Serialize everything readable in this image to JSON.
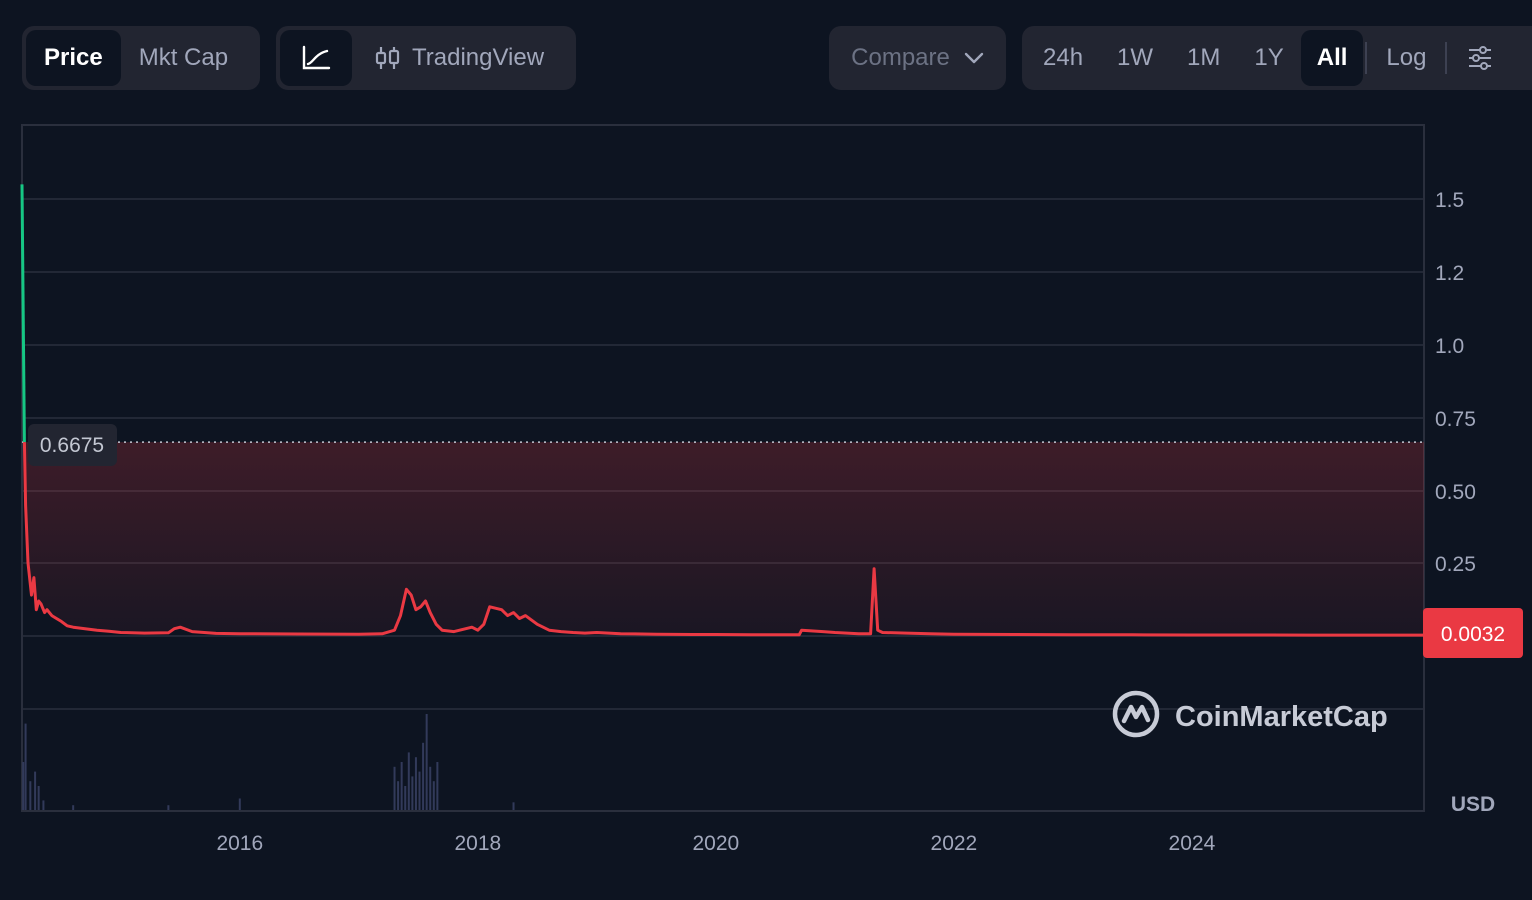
{
  "toolbar": {
    "price_label": "Price",
    "mktcap_label": "Mkt Cap",
    "tradingview_label": "TradingView",
    "compare_label": "Compare",
    "ranges": [
      "24h",
      "1W",
      "1M",
      "1Y",
      "All"
    ],
    "active_range": "All",
    "log_label": "Log"
  },
  "colors": {
    "background": "#0d1421",
    "line_down": "#ea3943",
    "line_up": "#16c784",
    "grid": "#2a2f3d",
    "volume": "#323a5a"
  },
  "watermark": "CoinMarketCap",
  "currency": "USD",
  "chart_data": {
    "type": "line",
    "yticks": [
      "1.5",
      "1.2",
      "1.0",
      "0.75",
      "0.50",
      "0.25"
    ],
    "xticks": [
      "2016",
      "2018",
      "2020",
      "2022",
      "2024"
    ],
    "start_price_label": "0.6675",
    "current_price_label": "0.0032",
    "start_price": 0.6675,
    "current_price": 0.0032,
    "ylim": [
      0,
      1.75
    ],
    "xlim": [
      2014.17,
      2025.95
    ],
    "series": [
      {
        "x": [
          2014.17,
          2014.19,
          2014.2,
          2014.22,
          2014.25,
          2014.27,
          2014.29,
          2014.31,
          2014.33,
          2014.36,
          2014.38,
          2014.42,
          2014.46,
          2014.5,
          2014.55,
          2014.6,
          2014.7,
          2014.8,
          2014.9,
          2015.0,
          2015.2,
          2015.4,
          2015.45,
          2015.5,
          2015.6,
          2015.8,
          2016.0,
          2016.5,
          2017.0,
          2017.2,
          2017.3,
          2017.35,
          2017.4,
          2017.44,
          2017.48,
          2017.52,
          2017.56,
          2017.6,
          2017.65,
          2017.7,
          2017.8,
          2017.95,
          2018.0,
          2018.05,
          2018.1,
          2018.2,
          2018.25,
          2018.3,
          2018.35,
          2018.4,
          2018.5,
          2018.6,
          2018.7,
          2018.8,
          2018.9,
          2019.0,
          2019.2,
          2019.5,
          2019.8,
          2020.0,
          2020.3,
          2020.7,
          2020.72,
          2020.9,
          2021.0,
          2021.1,
          2021.2,
          2021.3,
          2021.33,
          2021.36,
          2021.4,
          2021.6,
          2021.8,
          2022.0,
          2022.5,
          2023.0,
          2023.5,
          2024.0,
          2024.5,
          2025.0,
          2025.5,
          2025.95
        ],
        "y": [
          1.55,
          0.6675,
          0.45,
          0.25,
          0.14,
          0.2,
          0.09,
          0.12,
          0.11,
          0.08,
          0.09,
          0.07,
          0.06,
          0.05,
          0.035,
          0.03,
          0.025,
          0.02,
          0.016,
          0.012,
          0.01,
          0.011,
          0.025,
          0.03,
          0.015,
          0.009,
          0.008,
          0.007,
          0.006,
          0.008,
          0.02,
          0.07,
          0.16,
          0.14,
          0.09,
          0.1,
          0.12,
          0.08,
          0.04,
          0.02,
          0.015,
          0.03,
          0.02,
          0.04,
          0.1,
          0.09,
          0.07,
          0.08,
          0.06,
          0.07,
          0.04,
          0.02,
          0.015,
          0.012,
          0.01,
          0.012,
          0.008,
          0.006,
          0.005,
          0.005,
          0.004,
          0.004,
          0.02,
          0.015,
          0.012,
          0.01,
          0.008,
          0.008,
          0.23,
          0.02,
          0.012,
          0.01,
          0.008,
          0.006,
          0.005,
          0.004,
          0.004,
          0.0035,
          0.0033,
          0.0032,
          0.0032,
          0.0032
        ]
      }
    ],
    "volume": {
      "x": [
        2014.18,
        2014.2,
        2014.24,
        2014.28,
        2014.31,
        2014.35,
        2014.6,
        2015.4,
        2016.0,
        2017.3,
        2017.33,
        2017.36,
        2017.39,
        2017.42,
        2017.45,
        2017.48,
        2017.51,
        2017.54,
        2017.57,
        2017.6,
        2017.63,
        2017.66,
        2018.3
      ],
      "v": [
        0.5,
        0.9,
        0.3,
        0.4,
        0.25,
        0.1,
        0.05,
        0.05,
        0.12,
        0.45,
        0.3,
        0.5,
        0.25,
        0.6,
        0.35,
        0.55,
        0.4,
        0.7,
        1.0,
        0.45,
        0.3,
        0.5,
        0.08
      ]
    }
  }
}
